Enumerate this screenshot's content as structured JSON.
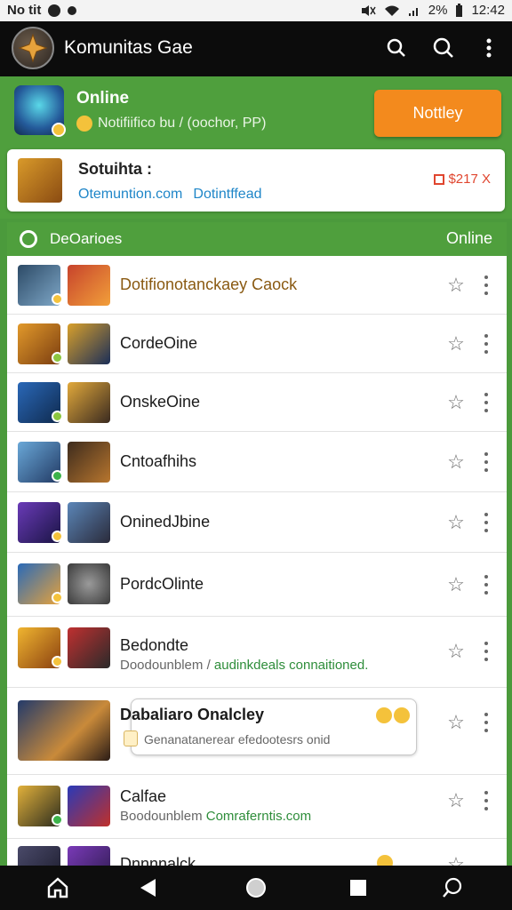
{
  "status_bar": {
    "left_text": "No tit",
    "time": "12:42",
    "right_text": "2%"
  },
  "app_bar": {
    "title": "Komunitas Gae",
    "icons": [
      "search-icon",
      "search-icon",
      "more-vert-icon"
    ]
  },
  "promo": {
    "title": "Online",
    "subtitle": "Notifiifico bu / (oochor, PP)",
    "button_label": "Nottley"
  },
  "info_card": {
    "title": "Sotuihta :",
    "link_1": "Otemuntion.com",
    "link_2": "Dotintffead",
    "price": "$217 X"
  },
  "list_header": {
    "label": "DeOarioes",
    "right_label": "Online"
  },
  "rows": [
    {
      "title": "Dotifionotanckaey Caock",
      "subtitle": "",
      "subtitle_green": ""
    },
    {
      "title": "CordeOine",
      "subtitle": "",
      "subtitle_green": ""
    },
    {
      "title": "OnskeOine",
      "subtitle": "",
      "subtitle_green": ""
    },
    {
      "title": "Cntoafhihs",
      "subtitle": "",
      "subtitle_green": ""
    },
    {
      "title": "OninedJbine",
      "subtitle": "",
      "subtitle_green": ""
    },
    {
      "title": "PordcOlinte",
      "subtitle": "",
      "subtitle_green": ""
    },
    {
      "title": "Bedondte",
      "subtitle": "Doodounblem /",
      "subtitle_green": "audinkdeals connaitioned."
    },
    {
      "title": "Dabaliaro Onalcley",
      "subtitle": "Genanatanerear efedootesrs onid",
      "subtitle_green": ""
    },
    {
      "title": "Calfae",
      "subtitle": "Boodounblem",
      "subtitle_green": "Comraferntis.com"
    },
    {
      "title": "Dnnnnalck",
      "subtitle": "",
      "subtitle_green": ""
    }
  ],
  "colors": {
    "brand_green": "#4f9f3d",
    "accent_orange": "#f38a1d",
    "link_blue": "#1f86c8",
    "price_red": "#e0462f"
  }
}
